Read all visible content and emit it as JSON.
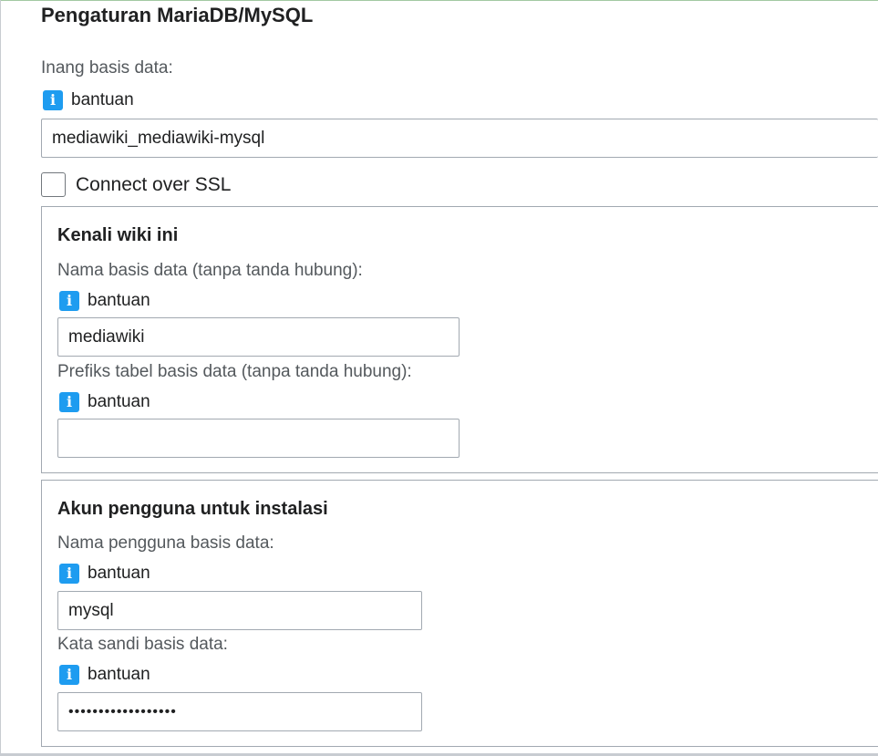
{
  "heading": "Pengaturan MariaDB/MySQL",
  "help_label": "bantuan",
  "db_host": {
    "label": "Inang basis data:",
    "value": "mediawiki_mediawiki-mysql"
  },
  "ssl": {
    "label": "Connect over SSL",
    "checked": false
  },
  "identify_wiki": {
    "title": "Kenali wiki ini",
    "db_name_label": "Nama basis data (tanpa tanda hubung):",
    "db_name_value": "mediawiki",
    "table_prefix_label": "Prefiks tabel basis data (tanpa tanda hubung):",
    "table_prefix_value": ""
  },
  "install_account": {
    "title": "Akun pengguna untuk instalasi",
    "db_user_label": "Nama pengguna basis data:",
    "db_user_value": "mysql",
    "db_password_label": "Kata sandi basis data:",
    "db_password_value": "••••••••••••••••••"
  },
  "icons": {
    "help": "info-icon"
  },
  "colors": {
    "info_icon": "#1e9cf0",
    "border": "#a2a9b1",
    "label_text": "#54595d"
  }
}
